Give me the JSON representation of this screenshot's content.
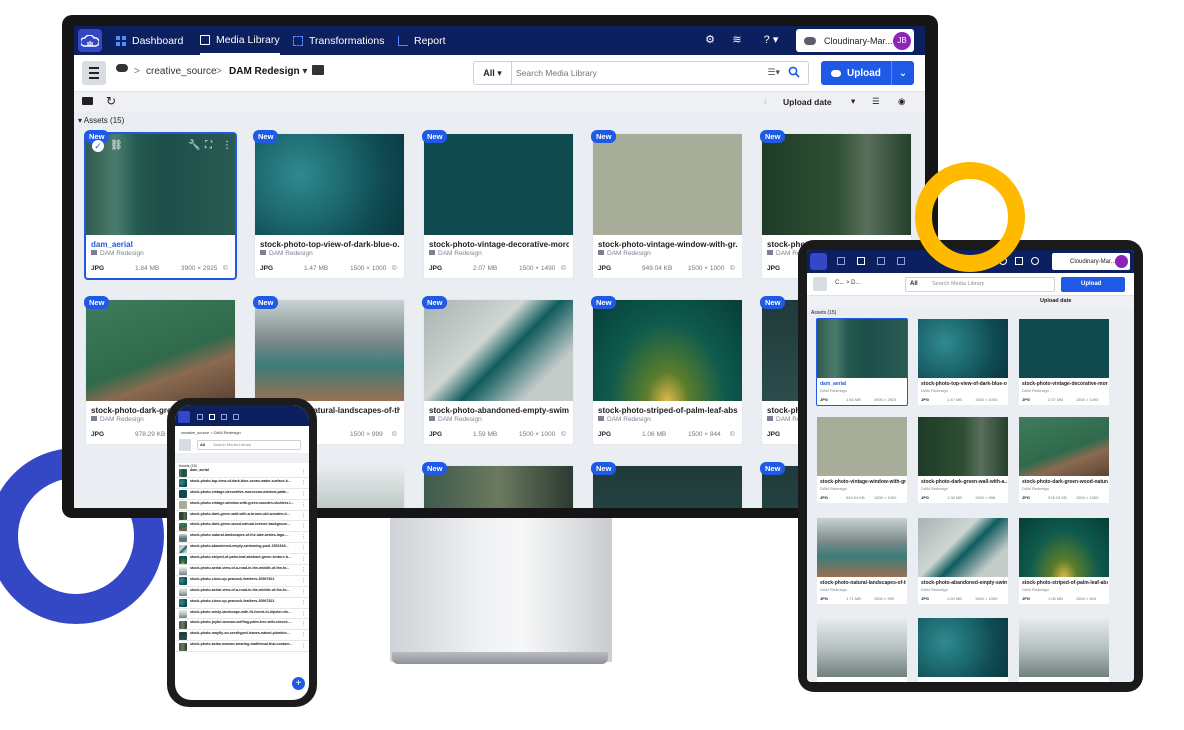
{
  "colors": {
    "nav_bg": "#0c1f5e",
    "accent": "#1e5ae6",
    "brand": "#3448c5",
    "avatar": "#8b25b9",
    "decor_yellow": "#ffba00"
  },
  "nav": {
    "items": [
      {
        "label": "Dashboard",
        "icon": "dashboard-icon"
      },
      {
        "label": "Media Library",
        "icon": "media-library-icon"
      },
      {
        "label": "Transformations",
        "icon": "transformations-icon"
      },
      {
        "label": "Report",
        "icon": "report-icon"
      }
    ],
    "account_name": "Cloudinary-Mar...",
    "avatar_initials": "JB"
  },
  "breadcrumb": {
    "root": "creative_source",
    "sep": ">",
    "current": "DAM Redesign"
  },
  "search": {
    "scope": "All",
    "placeholder": "Search Media Library"
  },
  "upload_label": "Upload",
  "sort": {
    "label": "Upload date"
  },
  "assets_label": "Assets (15)",
  "badge": "New",
  "cards": [
    {
      "name": "dam_aerial",
      "folder": "DAM Redesign",
      "format": "JPG",
      "size": "1.84 MB",
      "dims": "3900 × 2925"
    },
    {
      "name": "stock-photo-top-view-of-dark-blue-o...",
      "folder": "DAM Redesign",
      "format": "JPG",
      "size": "1.47 MB",
      "dims": "1500 × 1000"
    },
    {
      "name": "stock-photo-vintage-decorative-moro...",
      "folder": "DAM Redesign",
      "format": "JPG",
      "size": "2.07 MB",
      "dims": "1500 × 1490"
    },
    {
      "name": "stock-photo-vintage-window-with-gr...",
      "folder": "DAM Redesign",
      "format": "JPG",
      "size": "949.04 KB",
      "dims": "1500 × 1000"
    },
    {
      "name": "stock-photo-dark-green...",
      "folder": "DAM Redesign",
      "format": "JPG",
      "size": "",
      "dims": ""
    },
    {
      "name": "stock-photo-dark-green...",
      "folder": "DAM Redesign",
      "format": "JPG",
      "size": "978.29 KB",
      "dims": ""
    },
    {
      "name": "stock-photo-natural-landscapes-of-th...",
      "folder": "DAM Redesign",
      "format": "JPG",
      "size": "",
      "dims": "1500 × 999"
    },
    {
      "name": "stock-photo-abandoned-empty-swim...",
      "folder": "DAM Redesign",
      "format": "JPG",
      "size": "1.59 MB",
      "dims": "1500 × 1000"
    },
    {
      "name": "stock-photo-striped-of-palm-leaf-abs...",
      "folder": "DAM Redesign",
      "format": "JPG",
      "size": "1.06 MB",
      "dims": "1500 × 844"
    },
    {
      "name": "stock-ph...",
      "folder": "DAM Redesign",
      "format": "JPG",
      "size": "",
      "dims": ""
    }
  ],
  "tablet": {
    "account_name": "Cloudinary-Mar...",
    "crumb": "C... > D...",
    "search_placeholder": "Search Media Library",
    "search_scope": "All",
    "upload_label": "Upload",
    "sort_label": "Upload date",
    "assets_label": "Assets (15)",
    "cards": [
      {
        "name": "dam_aerial",
        "folder": "DAM Redesign",
        "format": "JPG",
        "size": "1.84 MB",
        "dims": "3900 × 2925"
      },
      {
        "name": "stock-photo-top-view-of-dark-blue-o...",
        "folder": "DAM Redesign",
        "format": "JPG",
        "size": "1.47 MB",
        "dims": "1500 × 1000"
      },
      {
        "name": "stock-photo-vintage-decorative-moro...",
        "folder": "DAM Redesign",
        "format": "JPG",
        "size": "2.07 MB",
        "dims": "1500 × 1490"
      },
      {
        "name": "stock-photo-vintage-window-with-gr...",
        "folder": "DAM Redesign",
        "format": "JPG",
        "size": "949.04 KB",
        "dims": "1500 × 1000"
      },
      {
        "name": "stock-photo-dark-green-wall-with-a...",
        "folder": "DAM Redesign",
        "format": "JPG",
        "size": "1.38 MB",
        "dims": "1500 × 998"
      },
      {
        "name": "stock-photo-dark-green-wood-natura...",
        "folder": "DAM Redesign",
        "format": "JPG",
        "size": "978.29 KB",
        "dims": "1500 × 1000"
      },
      {
        "name": "stock-photo-natural-landscapes-of-th...",
        "folder": "DAM Redesign",
        "format": "JPG",
        "size": "1.71 MB",
        "dims": "1500 × 999"
      },
      {
        "name": "stock-photo-abandoned-empty-swim...",
        "folder": "DAM Redesign",
        "format": "JPG",
        "size": "1.59 MB",
        "dims": "1500 × 1000"
      },
      {
        "name": "stock-photo-striped-of-palm-leaf-abs...",
        "folder": "DAM Redesign",
        "format": "JPG",
        "size": "1.06 MB",
        "dims": "1500 × 844"
      }
    ]
  },
  "phone": {
    "crumb": "creative_source > DAM Redesign",
    "search_scope": "All",
    "search_placeholder": "Search Media Library",
    "assets_label": "Assets (15)",
    "rows": [
      "dam_aerial",
      "stock-photo-top-view-of-dark-blue-ocean-water-surface-b...",
      "stock-photo-vintage-decorative-moroccan-window-patte...",
      "stock-photo-vintage-window-with-green-wooden-shutters-t...",
      "stock-photo-dark-green-wall-with-a-brown-old-wooden-d...",
      "stock-photo-dark-green-wood-natural-texture-backgroun...",
      "stock-photo-natural-landscapes-of-the-lake-braies-lago-...",
      "stock-photo-abandoned-empty-swimming-pool-1551918...",
      "stock-photo-striped-of-palm-leaf-abstract-green-texture-b...",
      "stock-photo-aerial-view-of-a-road-in-the-middle-of-the-fo...",
      "stock-photo-close-up-peacock-feathers-30967821",
      "stock-photo-aerial-view-of-a-road-in-the-middle-of-the-fo...",
      "stock-photo-close-up-peacock-feathers-30967821",
      "stock-photo-misty-landscape-with-fir-forest-in-hipster-vin...",
      "stock-photo-joyful-woman-sniffing-palm-tree-with-closed-...",
      "stock-photo-mayfly-on-seedtyped-leaves-naked-plumbin...",
      "stock-photo-asian-woman-wearing-traditional-thai-costum..."
    ]
  }
}
